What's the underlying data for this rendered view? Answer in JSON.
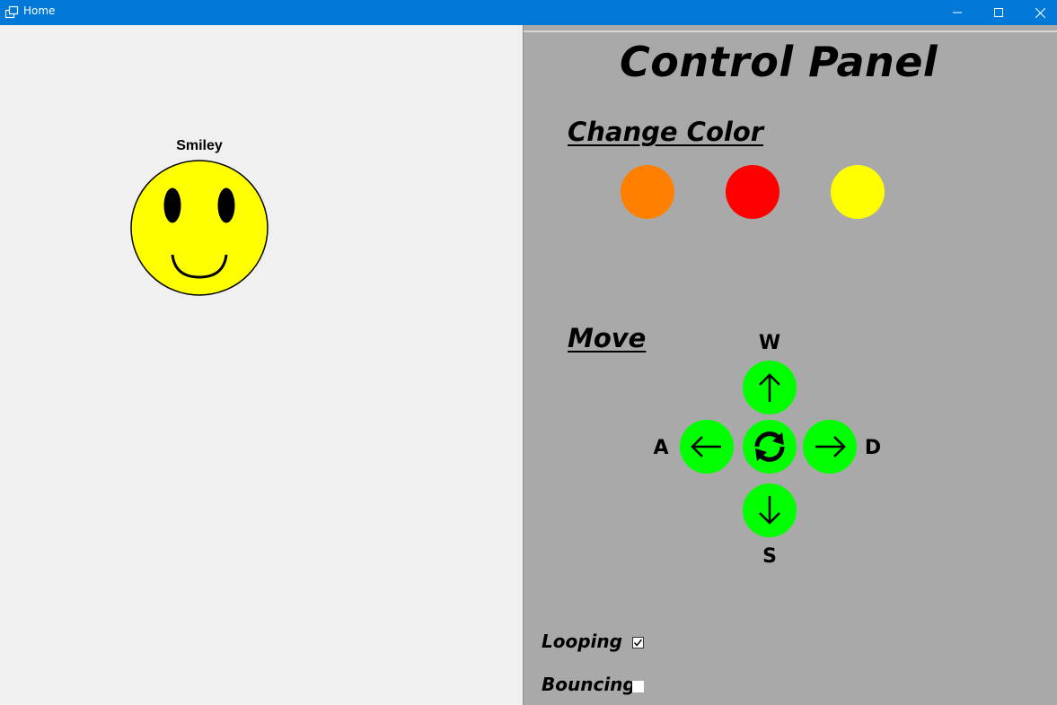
{
  "window": {
    "title": "Home"
  },
  "canvas": {
    "smiley_label": "Smiley"
  },
  "panel": {
    "title": "Control Panel",
    "change_color": {
      "heading": "Change Color",
      "swatches": [
        {
          "name": "orange",
          "color": "#ff7f00"
        },
        {
          "name": "red",
          "color": "#ff0000"
        },
        {
          "name": "yellow",
          "color": "#ffff00"
        }
      ]
    },
    "move": {
      "heading": "Move",
      "keys": {
        "up": "W",
        "left": "A",
        "right": "D",
        "down": "S"
      },
      "button_color": "#00ff00",
      "icons": [
        "arrow-up-icon",
        "arrow-left-icon",
        "refresh-icon",
        "arrow-right-icon",
        "arrow-down-icon"
      ]
    },
    "options": {
      "looping": {
        "label": "Looping",
        "checked": true
      },
      "bouncing": {
        "label": "Bouncing",
        "checked": false
      }
    }
  },
  "colors": {
    "titlebar": "#0078d7",
    "panel_bg": "#a9a9a9",
    "canvas_bg": "#f0f0f0",
    "smiley_face": "#ffff00"
  }
}
